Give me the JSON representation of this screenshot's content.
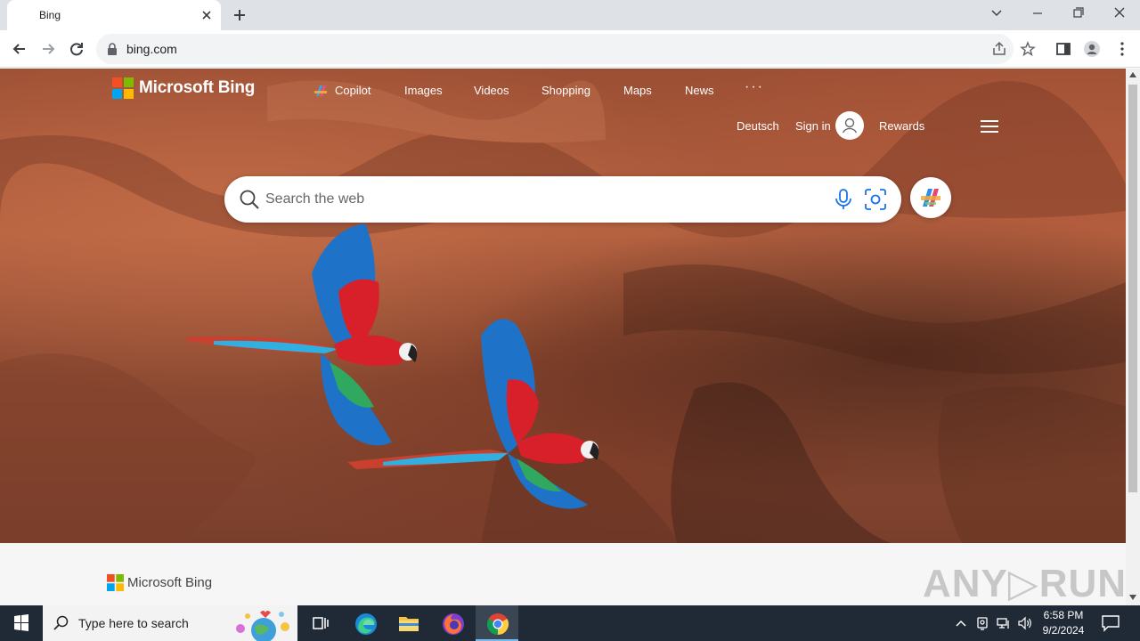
{
  "browser": {
    "tab_title": "Bing",
    "url": "bing.com"
  },
  "bing": {
    "logo_text": "Microsoft Bing",
    "nav": [
      "Copilot",
      "Images",
      "Videos",
      "Shopping",
      "Maps",
      "News"
    ],
    "nav_more": "···",
    "language": "Deutsch",
    "sign_in": "Sign in",
    "rewards": "Rewards",
    "search_placeholder": "Search the web",
    "footer_logo_text": "Microsoft Bing"
  },
  "watermark": "ANY▷RUN",
  "taskbar": {
    "search_placeholder": "Type here to search",
    "time": "6:58 PM",
    "date": "9/2/2024"
  },
  "colors": {
    "tabstrip": "#dee1e6",
    "taskbar": "#202a36",
    "accent_blue": "#1a73e8"
  }
}
